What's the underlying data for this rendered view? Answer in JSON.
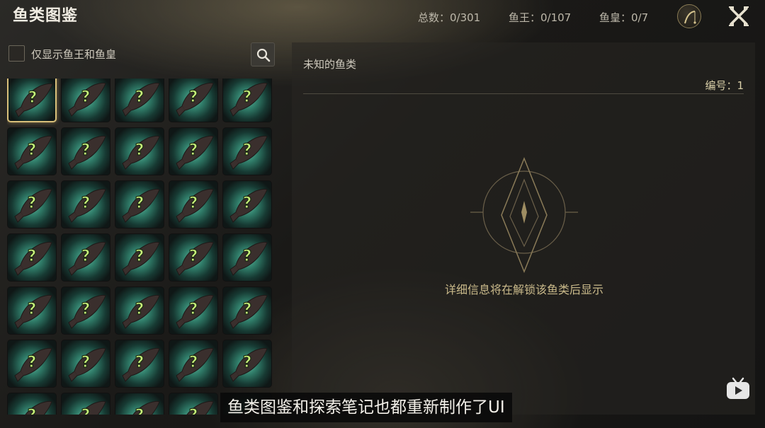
{
  "header": {
    "title": "鱼类图鉴",
    "stats": {
      "total": "总数：0/301",
      "king": "鱼王：0/107",
      "emperor": "鱼皇：0/7"
    }
  },
  "filter": {
    "label": "仅显示鱼王和鱼皇",
    "checked": false
  },
  "grid": {
    "columns": 5,
    "visible_rows": 7,
    "cell_state": "unknown",
    "cell_glyph": "?",
    "selected_index": 0
  },
  "detail": {
    "title": "未知的鱼类",
    "number": "编号：1",
    "hint": "详细信息将在解锁该鱼类后显示"
  },
  "subtitle": "鱼类图鉴和探索笔记也都重新制作了UI",
  "icons": {
    "search": "search-icon",
    "rod": "fishing-rod-icon",
    "close": "crossed-swords-close-icon",
    "emblem": "compass-emblem-icon",
    "watermark": "bilibili-tv-icon"
  },
  "colors": {
    "accent_gold": "#d9c07a",
    "cell_glow": "#63bfa4",
    "question_mark": "#c8f07a"
  }
}
